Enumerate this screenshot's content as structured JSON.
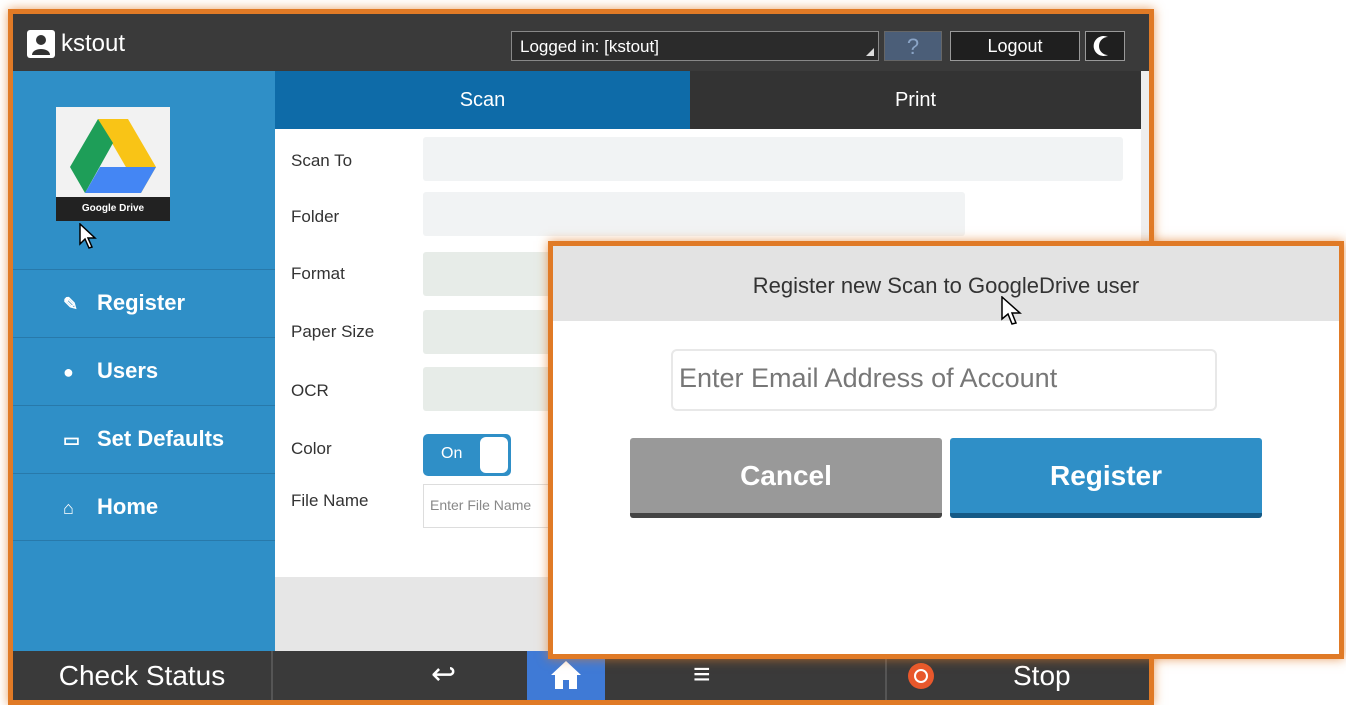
{
  "topbar": {
    "username": "kstout",
    "logged_in": "Logged in: [kstout]",
    "help": "?",
    "logout": "Logout"
  },
  "sidebar": {
    "app_caption": "Google Drive",
    "items": [
      {
        "label": "Register",
        "icon": "edit-icon"
      },
      {
        "label": "Users",
        "icon": "user-icon"
      },
      {
        "label": "Set Defaults",
        "icon": "keyboard-icon"
      },
      {
        "label": "Home",
        "icon": "home-icon"
      }
    ]
  },
  "tabs": {
    "scan": "Scan",
    "print": "Print"
  },
  "form": {
    "scan_to": "Scan To",
    "folder": "Folder",
    "format": "Format",
    "paper_size": "Paper Size",
    "ocr": "OCR",
    "color": "Color",
    "color_toggle": "On",
    "file_name": "File Name",
    "file_name_placeholder": "Enter File Name"
  },
  "bottombar": {
    "check_status": "Check Status",
    "back_glyph": "↩",
    "menu_glyph": "≡",
    "stop": "Stop"
  },
  "dialog": {
    "title": "Register new Scan to GoogleDrive user",
    "email_placeholder": "Enter Email Address of Account",
    "cancel": "Cancel",
    "register": "Register"
  },
  "colors": {
    "accent_blue": "#2f8fc7",
    "highlight_orange": "#e07a26",
    "dark_bar": "#3a3a3a"
  }
}
